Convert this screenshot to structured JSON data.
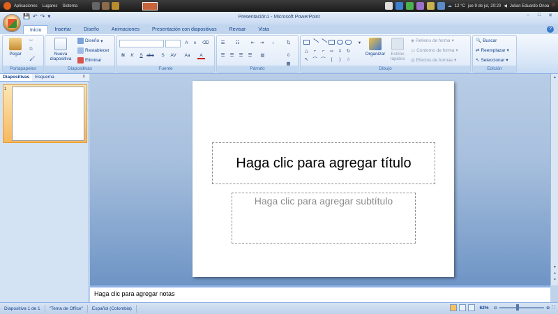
{
  "system_bar": {
    "menus": [
      "Aplicaciones",
      "Lugares",
      "Sistema"
    ],
    "weather": "12 °C",
    "clock": "jue  9 de jul, 20:20",
    "user": "Julian Eduardo Onoa"
  },
  "window": {
    "title": "Presentación1 - Microsoft PowerPoint"
  },
  "tabs": [
    "Inicio",
    "Insertar",
    "Diseño",
    "Animaciones",
    "Presentación con diapositivas",
    "Revisar",
    "Vista"
  ],
  "ribbon": {
    "portapapeles": {
      "title": "Portapapeles",
      "paste": "Pegar"
    },
    "diapositivas": {
      "title": "Diapositivas",
      "new_slide_1": "Nueva",
      "new_slide_2": "diapositiva",
      "layout": "Diseño",
      "reset": "Restablecer",
      "delete": "Eliminar"
    },
    "fuente": {
      "title": "Fuente",
      "grow": "A",
      "shrink": "A",
      "bold": "N",
      "italic": "K",
      "underline": "S",
      "strike": "abc",
      "shadow": "S",
      "spacing": "AV",
      "case": "Aa",
      "color": "A"
    },
    "parrafo": {
      "title": "Párrafo"
    },
    "dibujo": {
      "title": "Dibujo",
      "arrange": "Organizar",
      "quick_styles_1": "Estilos",
      "quick_styles_2": "rápidos",
      "fill": "Relleno de forma",
      "outline": "Contorno de forma",
      "effects": "Efectos de formas"
    },
    "edicion": {
      "title": "Edición",
      "find": "Buscar",
      "replace": "Reemplazar",
      "select": "Seleccionar"
    }
  },
  "slides_panel": {
    "tab_slides": "Diapositivas",
    "tab_outline": "Esquema",
    "close": "x",
    "thumb_number": "1"
  },
  "slide": {
    "title_placeholder": "Haga clic para agregar título",
    "subtitle_placeholder": "Haga clic para agregar subtítulo"
  },
  "notes": {
    "placeholder": "Haga clic para agregar notas"
  },
  "status": {
    "slide": "Diapositiva 1 de 1",
    "theme": "\"Tema de Office\"",
    "language": "Español (Colombia)",
    "zoom": "62%"
  }
}
